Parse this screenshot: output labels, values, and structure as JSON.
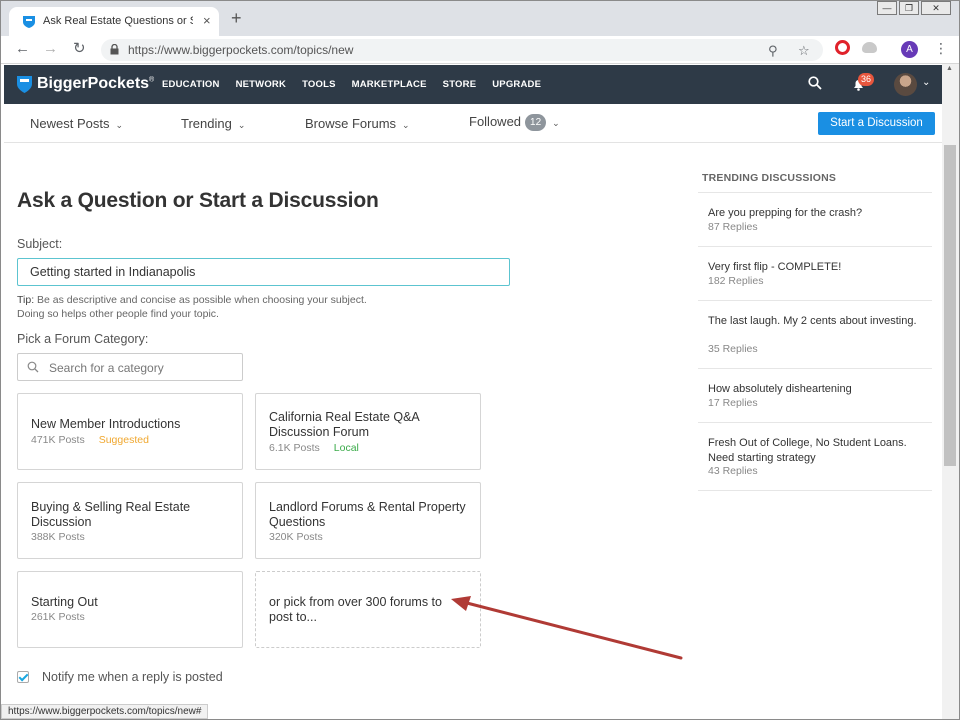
{
  "browser": {
    "tab_title": "Ask Real Estate Questions or Start a Discussion",
    "tab_close": "×",
    "new_tab": "+",
    "url": "https://www.biggerpockets.com/topics/new",
    "profile_initial": "A",
    "status_url": "https://www.biggerpockets.com/topics/new#"
  },
  "site": {
    "logo": "BiggerPockets",
    "logo_mark": "®",
    "nav": [
      "EDUCATION",
      "NETWORK",
      "TOOLS",
      "MARKETPLACE",
      "STORE",
      "UPGRADE"
    ],
    "notification_count": "36"
  },
  "subnav": {
    "newest": "Newest Posts",
    "trending": "Trending",
    "browse": "Browse Forums",
    "followed": "Followed",
    "followed_count": "12",
    "start_button": "Start a Discussion"
  },
  "form": {
    "title": "Ask a Question or Start a Discussion",
    "subject_label": "Subject:",
    "subject_value": "Getting started in Indianapolis",
    "tip_label": "Tip:",
    "tip_text_1": " Be as descriptive and concise as possible when choosing your subject.",
    "tip_text_2": "Doing so helps other people find your topic.",
    "category_label": "Pick a Forum Category:",
    "category_placeholder": "Search for a category",
    "notify_label": "Notify me when a reply is posted"
  },
  "categories": [
    {
      "name": "New Member Introductions",
      "posts": "471K Posts",
      "tag": "Suggested"
    },
    {
      "name": "California Real Estate Q&A Discussion Forum",
      "posts": "6.1K Posts",
      "tag": "Local"
    },
    {
      "name": "Buying & Selling Real Estate Discussion",
      "posts": "388K Posts"
    },
    {
      "name": "Landlord Forums & Rental Property Questions",
      "posts": "320K Posts"
    },
    {
      "name": "Starting Out",
      "posts": "261K Posts"
    },
    {
      "name": "or pick from over 300 forums to post to..."
    }
  ],
  "trending": {
    "heading": "TRENDING DISCUSSIONS",
    "items": [
      {
        "title": "Are you prepping for the crash?",
        "replies": "87 Replies"
      },
      {
        "title": "Very first flip - COMPLETE!",
        "replies": "182 Replies"
      },
      {
        "title": "The last laugh. My 2 cents about investing.",
        "replies": "35 Replies"
      },
      {
        "title": "How absolutely disheartening",
        "replies": "17 Replies"
      },
      {
        "title": "Fresh Out of College, No Student Loans. Need starting strategy",
        "replies": "43 Replies"
      }
    ]
  },
  "colors": {
    "header_bg": "#2e3a47",
    "primary_button": "#1a8fe3",
    "input_focus": "#5cc4d0",
    "annotation_arrow": "#b03a35"
  }
}
